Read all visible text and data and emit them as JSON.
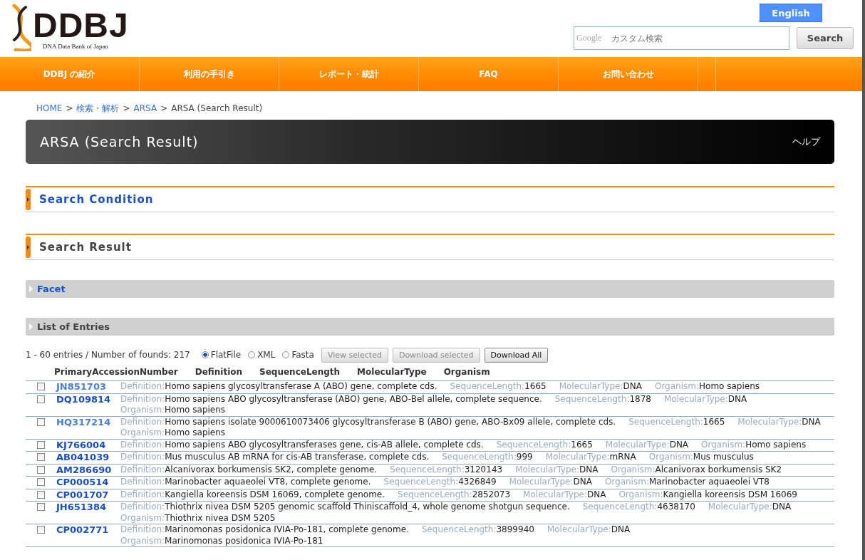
{
  "logo": {
    "name": "DDBJ",
    "subtitle": "DNA Data Bank of Japan"
  },
  "language_button": "English",
  "search": {
    "placeholder": "カスタム検索",
    "brand": "Google",
    "button": "Search"
  },
  "nav": [
    "DDBJ の紹介",
    "利用の手引き",
    "レポート・統計",
    "FAQ",
    "お問い合わせ"
  ],
  "breadcrumb": [
    {
      "label": "HOME",
      "link": true
    },
    {
      "separator": ">",
      "label": "検索・解析",
      "link": true
    },
    {
      "separator": ">",
      "label": "ARSA",
      "link": true
    },
    {
      "separator": ">",
      "label": "ARSA (Search Result)",
      "link": false
    }
  ],
  "banner": {
    "title": "ARSA (Search Result)",
    "help": "ヘルプ"
  },
  "sections": [
    {
      "title": "Search Condition",
      "link": true
    },
    {
      "title": "Search Result",
      "link": false
    }
  ],
  "panels": [
    {
      "title": "Facet",
      "link": true
    },
    {
      "title": "List of Entries",
      "link": false
    }
  ],
  "summary": "1 - 60 entries / Number of founds: 217",
  "formats": [
    {
      "label": "FlatFile",
      "selected": true
    },
    {
      "label": "XML",
      "selected": false
    },
    {
      "label": "Fasta",
      "selected": false
    }
  ],
  "actions": [
    {
      "label": "View selected",
      "disabled": true
    },
    {
      "label": "Download selected",
      "disabled": true
    },
    {
      "label": "Download All",
      "disabled": false
    }
  ],
  "columns": [
    "PrimaryAccessionNumber",
    "Definition",
    "SequenceLength",
    "MolecularType",
    "Organism"
  ],
  "entries": [
    {
      "accession": "JN851703",
      "visited": true,
      "checked": false,
      "fields": [
        {
          "label": "Definition:",
          "value": "Homo sapiens glycosyltransferase A (ABO) gene, complete cds."
        },
        {
          "label": "SequenceLength:",
          "value": "1665"
        },
        {
          "label": "MolecularType:",
          "value": "DNA"
        },
        {
          "label": "Organism:",
          "value": "Homo sapiens"
        }
      ]
    },
    {
      "accession": "DQ109814",
      "visited": false,
      "checked": false,
      "fields": [
        {
          "label": "Definition:",
          "value": "Homo sapiens ABO glycosyltransferase (ABO) gene, ABO-Bel allele, complete sequence."
        },
        {
          "label": "SequenceLength:",
          "value": "1878"
        },
        {
          "label": "MolecularType:",
          "value": "DNA"
        },
        {
          "label": "Organism:",
          "value": "Homo sapiens"
        }
      ]
    },
    {
      "accession": "HQ317214",
      "visited": true,
      "checked": false,
      "fields": [
        {
          "label": "Definition:",
          "value": "Homo sapiens isolate 9000610073406 glycosyltransferase B (ABO) gene, ABO-Bx09 allele, complete cds."
        },
        {
          "label": "SequenceLength:",
          "value": "1665"
        },
        {
          "label": "MolecularType:",
          "value": "DNA"
        },
        {
          "label": "Organism:",
          "value": "Homo sapiens"
        }
      ]
    },
    {
      "accession": "KJ766004",
      "visited": false,
      "checked": false,
      "fields": [
        {
          "label": "Definition:",
          "value": "Homo sapiens ABO glycosyltransferases gene, cis-AB allele, complete cds."
        },
        {
          "label": "SequenceLength:",
          "value": "1665"
        },
        {
          "label": "MolecularType:",
          "value": "DNA"
        },
        {
          "label": "Organism:",
          "value": "Homo sapiens"
        }
      ]
    },
    {
      "accession": "AB041039",
      "visited": false,
      "checked": false,
      "fields": [
        {
          "label": "Definition:",
          "value": "Mus musculus AB mRNA for cis-AB transferase, complete cds."
        },
        {
          "label": "SequenceLength:",
          "value": "999"
        },
        {
          "label": "MolecularType:",
          "value": "mRNA"
        },
        {
          "label": "Organism:",
          "value": "Mus musculus"
        }
      ]
    },
    {
      "accession": "AM286690",
      "visited": false,
      "checked": false,
      "fields": [
        {
          "label": "Definition:",
          "value": "Alcanivorax borkumensis SK2, complete genome."
        },
        {
          "label": "SequenceLength:",
          "value": "3120143"
        },
        {
          "label": "MolecularType:",
          "value": "DNA"
        },
        {
          "label": "Organism:",
          "value": "Alcanivorax borkumensis SK2"
        }
      ]
    },
    {
      "accession": "CP000514",
      "visited": false,
      "checked": false,
      "fields": [
        {
          "label": "Definition:",
          "value": "Marinobacter aquaeolei VT8, complete genome."
        },
        {
          "label": "SequenceLength:",
          "value": "4326849"
        },
        {
          "label": "MolecularType:",
          "value": "DNA"
        },
        {
          "label": "Organism:",
          "value": "Marinobacter aquaeolei VT8"
        }
      ]
    },
    {
      "accession": "CP001707",
      "visited": false,
      "checked": false,
      "fields": [
        {
          "label": "Definition:",
          "value": "Kangiella koreensis DSM 16069, complete genome."
        },
        {
          "label": "SequenceLength:",
          "value": "2852073"
        },
        {
          "label": "MolecularType:",
          "value": "DNA"
        },
        {
          "label": "Organism:",
          "value": "Kangiella koreensis DSM 16069"
        }
      ]
    },
    {
      "accession": "JH651384",
      "visited": false,
      "checked": false,
      "fields": [
        {
          "label": "Definition:",
          "value": "Thiothrix nivea DSM 5205 genomic scaffold Thiniscaffold_4, whole genome shotgun sequence."
        },
        {
          "label": "SequenceLength:",
          "value": "4638170"
        },
        {
          "label": "MolecularType:",
          "value": "DNA"
        },
        {
          "label": "Organism:",
          "value": "Thiothrix nivea DSM 5205"
        }
      ]
    },
    {
      "accession": "CP002771",
      "visited": false,
      "checked": false,
      "fields": [
        {
          "label": "Definition:",
          "value": "Marinomonas posidonica IVIA-Po-181, complete genome."
        },
        {
          "label": "SequenceLength:",
          "value": "3899940"
        },
        {
          "label": "MolecularType:",
          "value": "DNA"
        },
        {
          "label": "Organism:",
          "value": "Marinomonas posidonica IVIA-Po-181"
        }
      ]
    }
  ]
}
